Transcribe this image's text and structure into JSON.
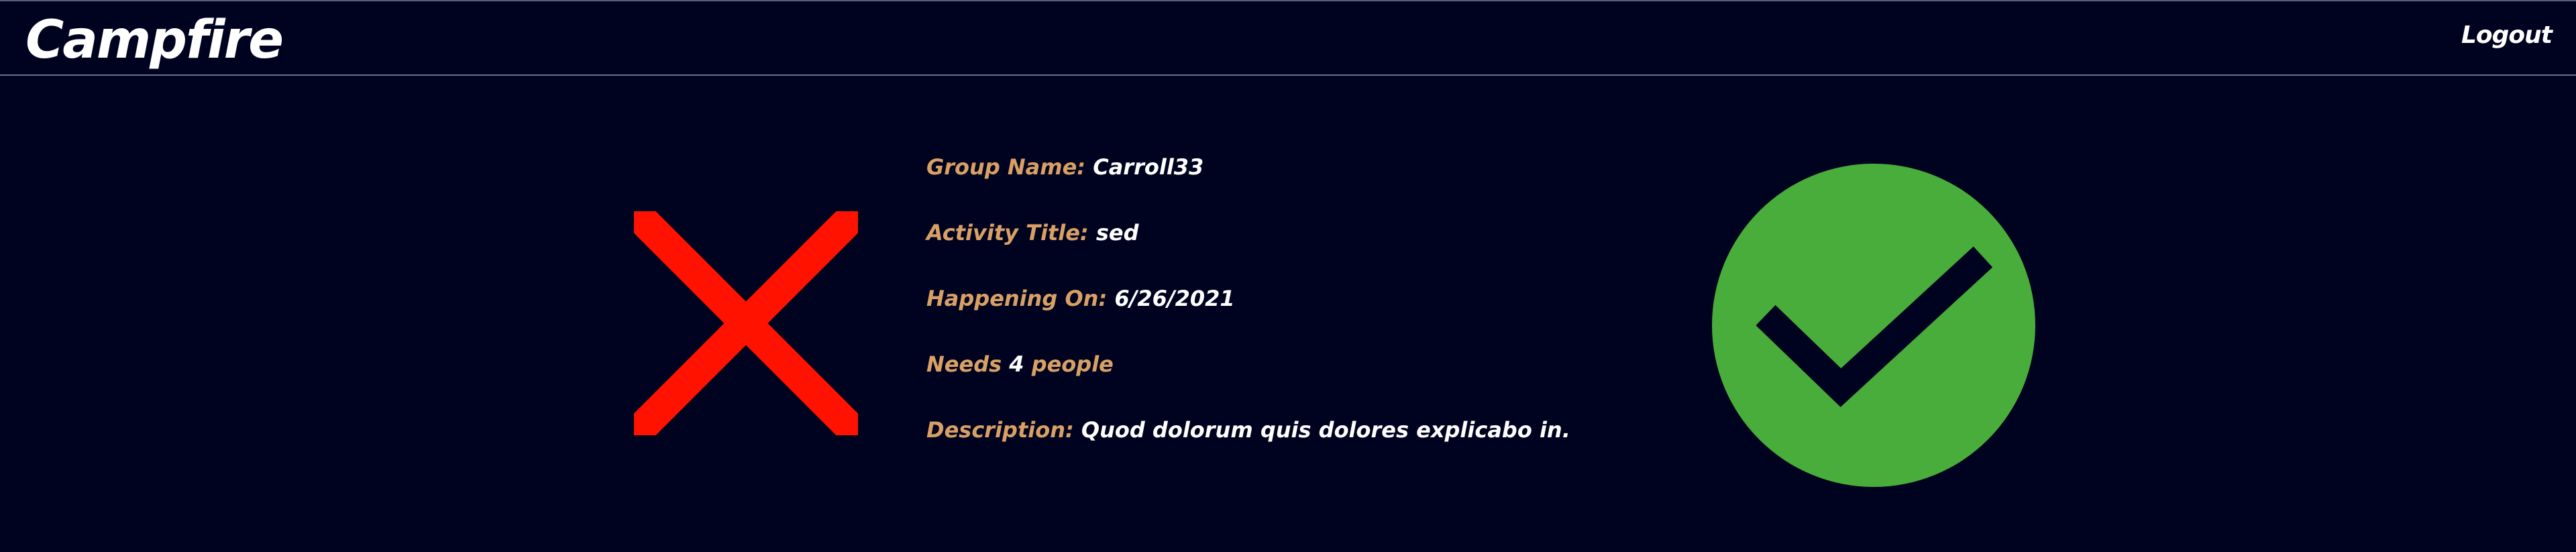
{
  "header": {
    "brand": "Campfire",
    "logout_label": "Logout"
  },
  "activity": {
    "group_name_label": "Group Name:",
    "group_name": "Carroll33",
    "activity_title_label": "Activity Title:",
    "activity_title": "sed",
    "happening_on_label": "Happening On:",
    "happening_on": "6/26/2021",
    "needs_prefix": "Needs",
    "needs_count": "4",
    "needs_suffix": "people",
    "description_label": "Description:",
    "description": "Quod dolorum quis dolores explicabo in."
  },
  "icons": {
    "reject": "close-x-icon",
    "accept": "check-circle-icon"
  },
  "colors": {
    "background": "#000320",
    "label": "#d9a065",
    "value": "#ffffff",
    "reject": "#ff1200",
    "accept": "#48ad3a"
  }
}
